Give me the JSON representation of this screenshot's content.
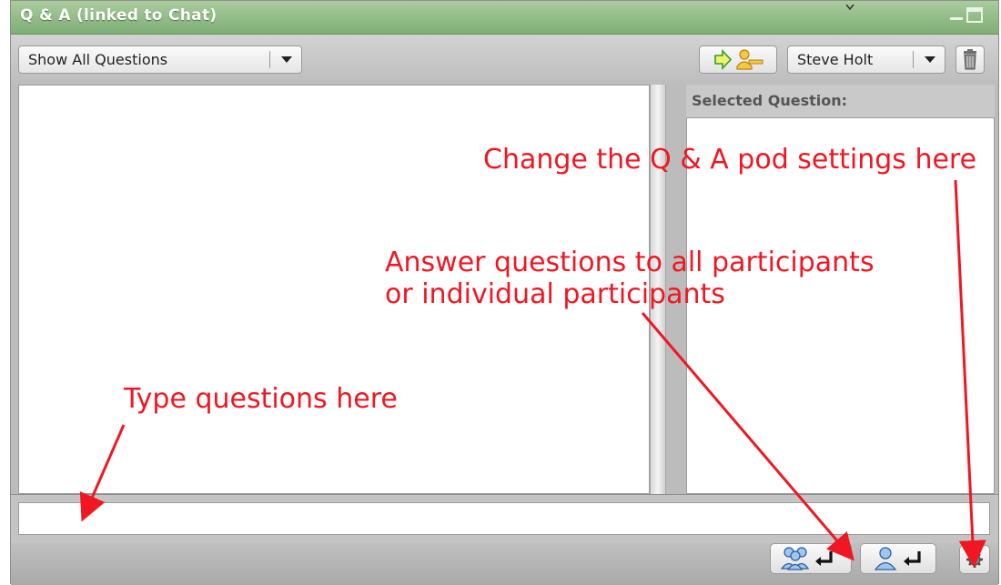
{
  "window": {
    "title": "Q & A (linked to Chat)"
  },
  "toolbar": {
    "filter_select": "Show All Questions",
    "user_select": "Steve Holt"
  },
  "details": {
    "header": "Selected Question:"
  },
  "input": {
    "value": "",
    "placeholder": ""
  },
  "annotations": {
    "settings": "Change the Q & A pod settings here",
    "answer": "Answer questions to all participants\nor individual participants",
    "type": "Type questions here"
  },
  "colors": {
    "titlebar": "#8fbb85",
    "annotation": "#f01722",
    "pod_background": "#bcbcbc"
  },
  "icons": {
    "assign": "arrow-to-user-icon",
    "trash": "trash-icon",
    "send_all": "send-to-all-participants-icon",
    "send_one": "send-to-individual-icon",
    "settings": "gear-icon"
  }
}
